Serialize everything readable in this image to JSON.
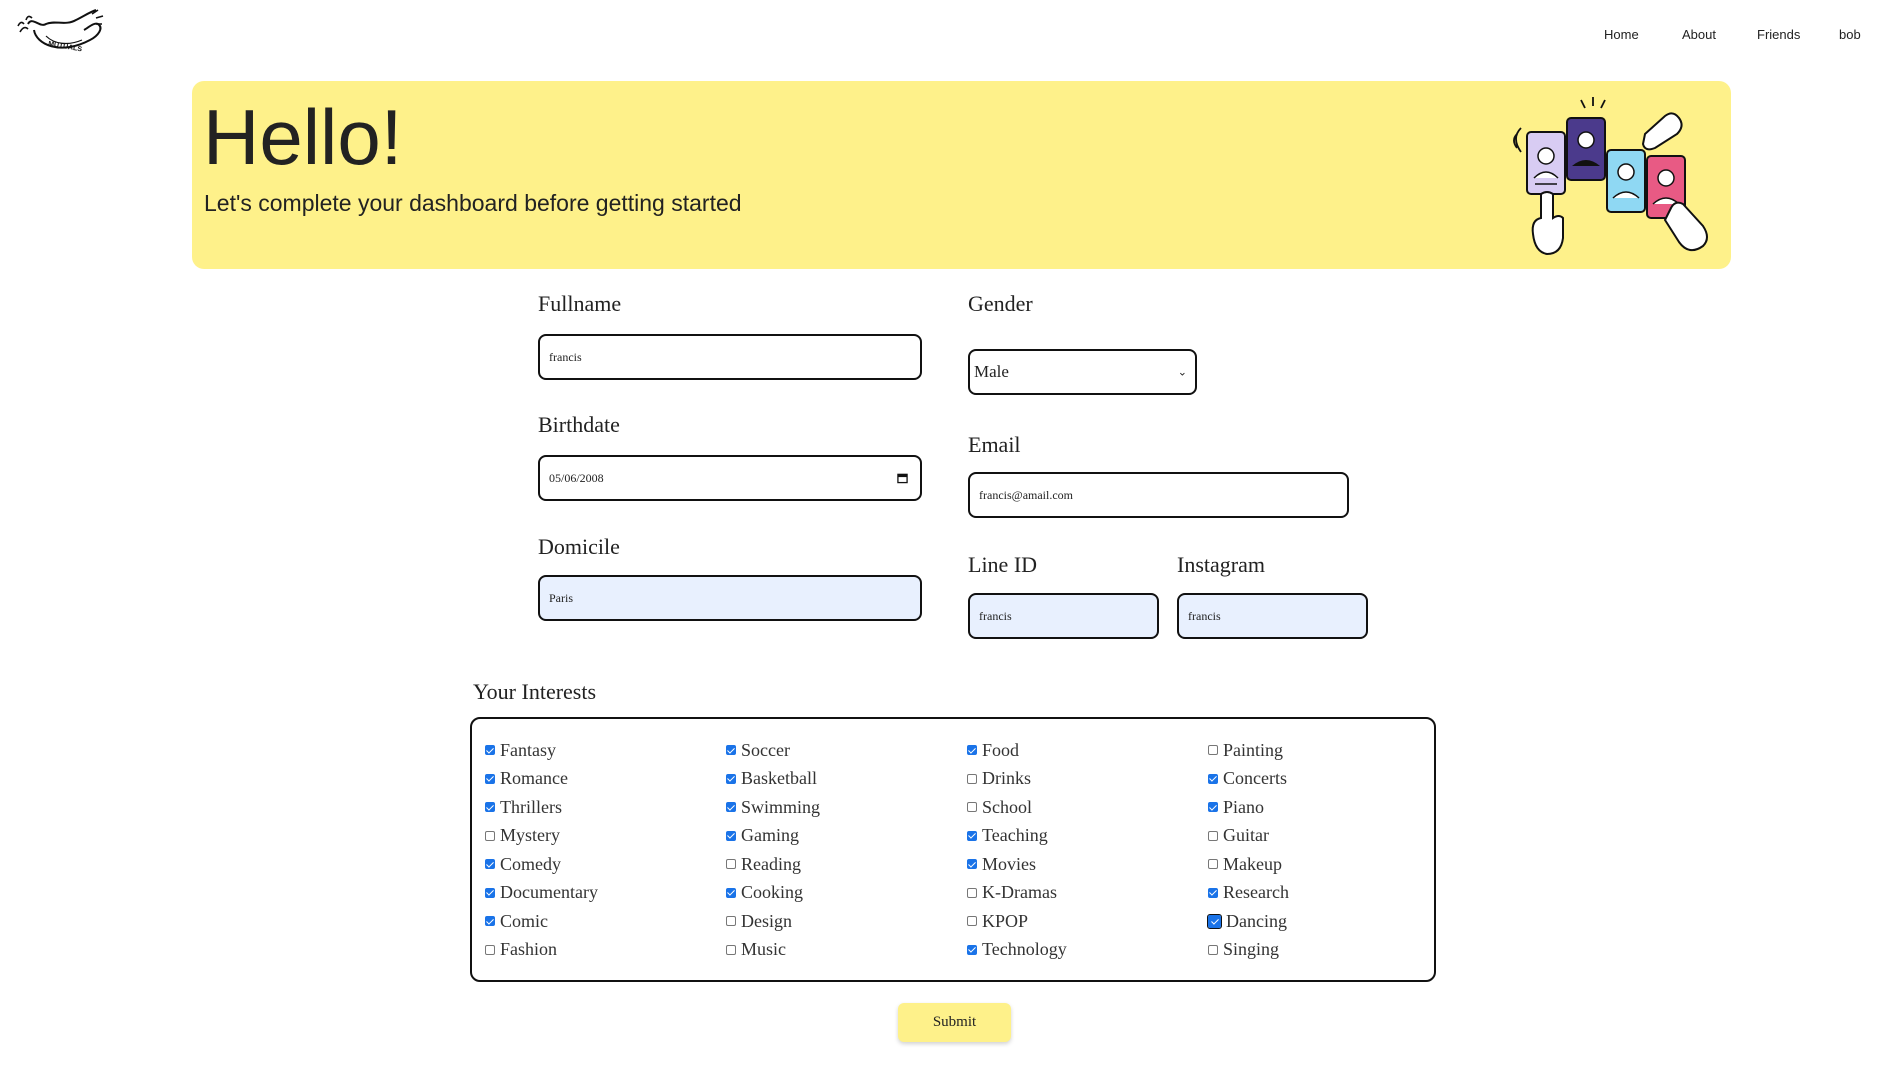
{
  "nav": {
    "logo_text": "MUTUALS",
    "links": [
      "Home",
      "About",
      "Friends",
      "bob"
    ]
  },
  "hero": {
    "title": "Hello!",
    "subtitle": "Let's complete your dashboard before getting started"
  },
  "form": {
    "fullname": {
      "label": "Fullname",
      "value": "francis"
    },
    "gender": {
      "label": "Gender",
      "value": "Male"
    },
    "birthdate": {
      "label": "Birthdate",
      "value": "05/06/2008"
    },
    "email": {
      "label": "Email",
      "value": "francis@amail.com"
    },
    "domicile": {
      "label": "Domicile",
      "value": "Paris"
    },
    "line_id": {
      "label": "Line ID",
      "value": "francis"
    },
    "instagram": {
      "label": "Instagram",
      "value": "francis"
    }
  },
  "interests": {
    "heading": "Your Interests",
    "columns": [
      [
        {
          "label": "Fantasy",
          "checked": true
        },
        {
          "label": "Romance",
          "checked": true
        },
        {
          "label": "Thrillers",
          "checked": true
        },
        {
          "label": "Mystery",
          "checked": false
        },
        {
          "label": "Comedy",
          "checked": true
        },
        {
          "label": "Documentary",
          "checked": true
        },
        {
          "label": "Comic",
          "checked": true
        },
        {
          "label": "Fashion",
          "checked": false
        }
      ],
      [
        {
          "label": "Soccer",
          "checked": true
        },
        {
          "label": "Basketball",
          "checked": true
        },
        {
          "label": "Swimming",
          "checked": true
        },
        {
          "label": "Gaming",
          "checked": true
        },
        {
          "label": "Reading",
          "checked": false
        },
        {
          "label": "Cooking",
          "checked": true
        },
        {
          "label": "Design",
          "checked": false
        },
        {
          "label": "Music",
          "checked": false
        }
      ],
      [
        {
          "label": "Food",
          "checked": true
        },
        {
          "label": "Drinks",
          "checked": false
        },
        {
          "label": "School",
          "checked": false
        },
        {
          "label": "Teaching",
          "checked": true
        },
        {
          "label": "Movies",
          "checked": true
        },
        {
          "label": "K-Dramas",
          "checked": false
        },
        {
          "label": "KPOP",
          "checked": false
        },
        {
          "label": "Technology",
          "checked": true
        }
      ],
      [
        {
          "label": "Painting",
          "checked": false
        },
        {
          "label": "Concerts",
          "checked": true
        },
        {
          "label": "Piano",
          "checked": true
        },
        {
          "label": "Guitar",
          "checked": false
        },
        {
          "label": "Makeup",
          "checked": false
        },
        {
          "label": "Research",
          "checked": true
        },
        {
          "label": "Dancing",
          "checked": true,
          "focused": true
        },
        {
          "label": "Singing",
          "checked": false
        }
      ]
    ]
  },
  "submit_label": "Submit",
  "colors": {
    "accent": "#fef18a",
    "checkbox": "#1a73e8",
    "autofill": "#e8f0fe"
  }
}
